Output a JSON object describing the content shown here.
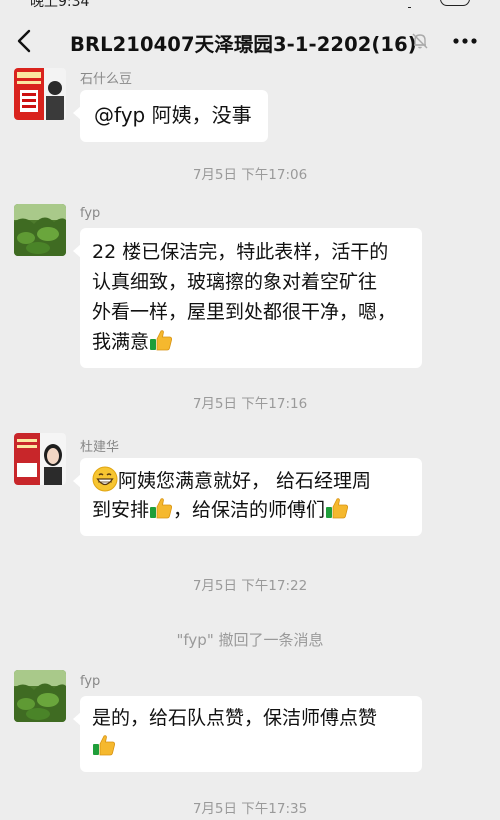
{
  "status_bar": {
    "time": "晚上9:34"
  },
  "header": {
    "title": "BRL210407天泽璟园3-1-2202(16)",
    "back_icon": "chevron-left-icon",
    "mute_icon": "bell-slash-icon",
    "more_icon": "more-horizontal-icon"
  },
  "messages": [
    {
      "sender": "石什么豆",
      "text": "@fyp 阿姨，没事"
    },
    {
      "timestamp": "7月5日 下午17:06"
    },
    {
      "sender": "fyp",
      "lines": [
        "22 楼已保洁完，特此表样，活干的",
        "认真细致，玻璃擦的象对着空矿往",
        "外看一样，屋里到处都很干净，嗯，",
        "我满意"
      ]
    },
    {
      "timestamp": "7月5日 下午17:16"
    },
    {
      "sender": "杜建华",
      "lines": [
        "阿姨您满意就好， 给石经理周",
        "到安排",
        "，给保洁的师傅们"
      ]
    },
    {
      "timestamp": "7月5日 下午17:22"
    },
    {
      "recall": "\"fyp\" 撤回了一条消息"
    },
    {
      "sender": "fyp",
      "lines": [
        "是的，给石队点赞，保洁师傅点赞"
      ]
    },
    {
      "timestamp": "7月5日 下午17:35"
    }
  ],
  "colors": {
    "background": "#ededed",
    "bubble": "#ffffff",
    "meta_text": "#9a9a9a"
  },
  "emoji": {
    "thumbs_up": "thumbs-up-icon",
    "grin": "grinning-face-icon"
  }
}
